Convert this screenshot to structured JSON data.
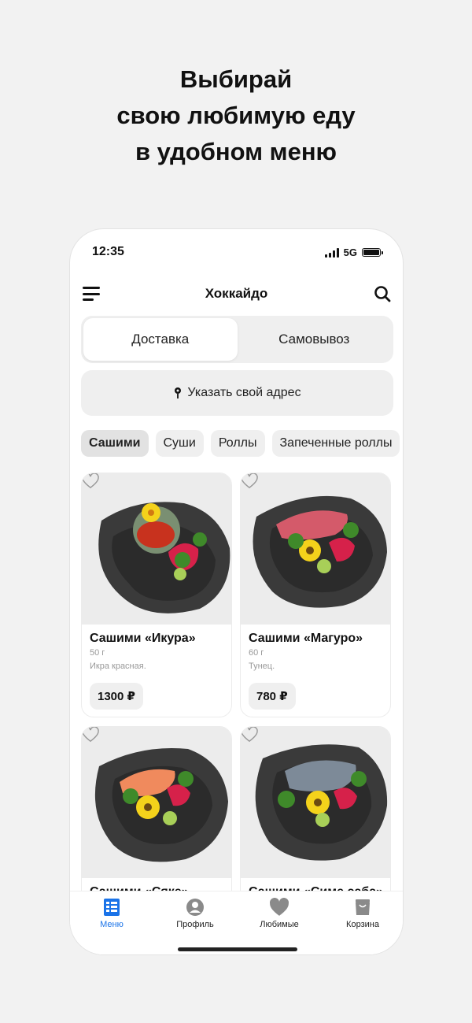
{
  "headline": {
    "line1": "Выбирай",
    "line2": "свою любимую еду",
    "line3": "в удобном меню"
  },
  "status": {
    "time": "12:35",
    "network": "5G"
  },
  "header": {
    "title": "Хоккайдо"
  },
  "delivery_toggle": {
    "options": [
      "Доставка",
      "Самовывоз"
    ],
    "selected": "Доставка"
  },
  "address": {
    "label": "Указать свой адрес"
  },
  "categories": {
    "items": [
      "Сашими",
      "Суши",
      "Роллы",
      "Запеченные роллы"
    ],
    "selected": "Сашими"
  },
  "products": [
    {
      "name": "Сашими «Икура»",
      "weight": "50 г",
      "description": "Икра красная.",
      "price": "1300 ₽"
    },
    {
      "name": "Сашими «Магуро»",
      "weight": "60 г",
      "description": "Тунец.",
      "price": "780 ₽"
    },
    {
      "name": "Сашими «Сяке»",
      "weight": "",
      "description": "",
      "price": ""
    },
    {
      "name": "Сашими «Симе саба»",
      "weight": "",
      "description": "",
      "price": ""
    }
  ],
  "tabbar": {
    "items": [
      "Меню",
      "Профиль",
      "Любимые",
      "Корзина"
    ],
    "active": "Меню"
  },
  "colors": {
    "accent": "#1a73e8",
    "chip_bg": "#efefef",
    "chip_active_bg": "#e2e2e2",
    "page_bg": "#f2f2f2"
  }
}
